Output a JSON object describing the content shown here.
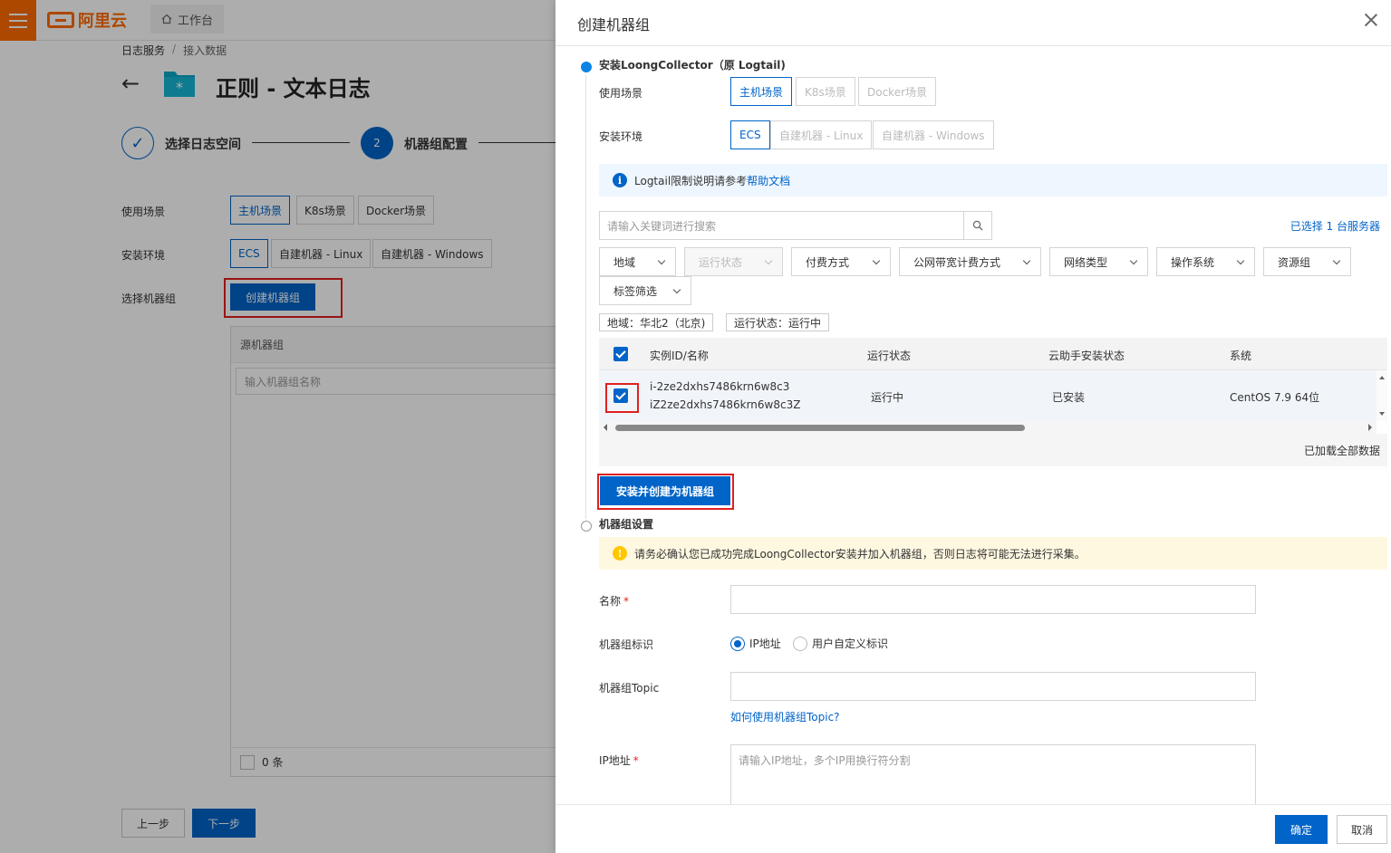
{
  "topbar": {
    "logo_text": "阿里云",
    "workbench_label": "工作台"
  },
  "breadcrumb": {
    "items": [
      "日志服务",
      "接入数据"
    ]
  },
  "page": {
    "title": "正则 - 文本日志"
  },
  "steps": [
    {
      "label": "选择日志空间"
    },
    {
      "number": "2",
      "label": "机器组配置"
    }
  ],
  "bg_form": {
    "scene_label": "使用场景",
    "scene_options": [
      "主机场景",
      "K8s场景",
      "Docker场景"
    ],
    "env_label": "安装环境",
    "env_options": [
      "ECS",
      "自建机器 - Linux",
      "自建机器 - Windows"
    ],
    "group_label": "选择机器组",
    "create_group_button": "创建机器组",
    "source_group_header": "源机器组",
    "source_group_search_placeholder": "输入机器组名称",
    "count_text": "0 条",
    "prev_button": "上一步",
    "next_button": "下一步"
  },
  "drawer": {
    "title": "创建机器组",
    "install_section": {
      "title": "安装LoongCollector（原 Logtail)",
      "scene_label": "使用场景",
      "scene_options": [
        "主机场景",
        "K8s场景",
        "Docker场景"
      ],
      "env_label": "安装环境",
      "env_options": [
        "ECS",
        "自建机器 - Linux",
        "自建机器 - Windows"
      ],
      "info_text": "Logtail限制说明请参考",
      "info_link": "帮助文档",
      "search_placeholder": "请输入关键词进行搜索",
      "selected_text": "已选择 1 台服务器",
      "filters": [
        "地域",
        "运行状态",
        "付费方式",
        "公网带宽计费方式",
        "网络类型",
        "操作系统",
        "资源组",
        "标签筛选"
      ],
      "active_tags": [
        "地域：华北2（北京)",
        "运行状态：运行中"
      ],
      "table": {
        "columns": [
          "实例ID/名称",
          "运行状态",
          "云助手安装状态",
          "系统"
        ],
        "rows": [
          {
            "instance_id": "i-2ze2dxhs7486krn6w8c3",
            "instance_name": "iZ2ze2dxhs7486krn6w8c3Z",
            "status": "运行中",
            "assistant_status": "已安装",
            "os": "CentOS 7.9 64位"
          }
        ],
        "footer_text": "已加载全部数据"
      },
      "install_button": "安装并创建为机器组"
    },
    "settings_section": {
      "title": "机器组设置",
      "warning_text": "请务必确认您已成功完成LoongCollector安装并加入机器组，否则日志将可能无法进行采集。",
      "name_label": "名称",
      "identity_label": "机器组标识",
      "identity_options": [
        "IP地址",
        "用户自定义标识"
      ],
      "topic_label": "机器组Topic",
      "topic_help_link": "如何使用机器组Topic?",
      "ip_label": "IP地址",
      "ip_placeholder": "请输入IP地址，多个IP用换行符分割",
      "required_mark": "*"
    },
    "footer": {
      "ok_button": "确定",
      "cancel_button": "取消"
    }
  },
  "colors": {
    "primary": "#0064c8",
    "brand": "#ff6a00",
    "highlight": "#e02020",
    "warning": "#ffc700",
    "info": "#0064c8"
  }
}
